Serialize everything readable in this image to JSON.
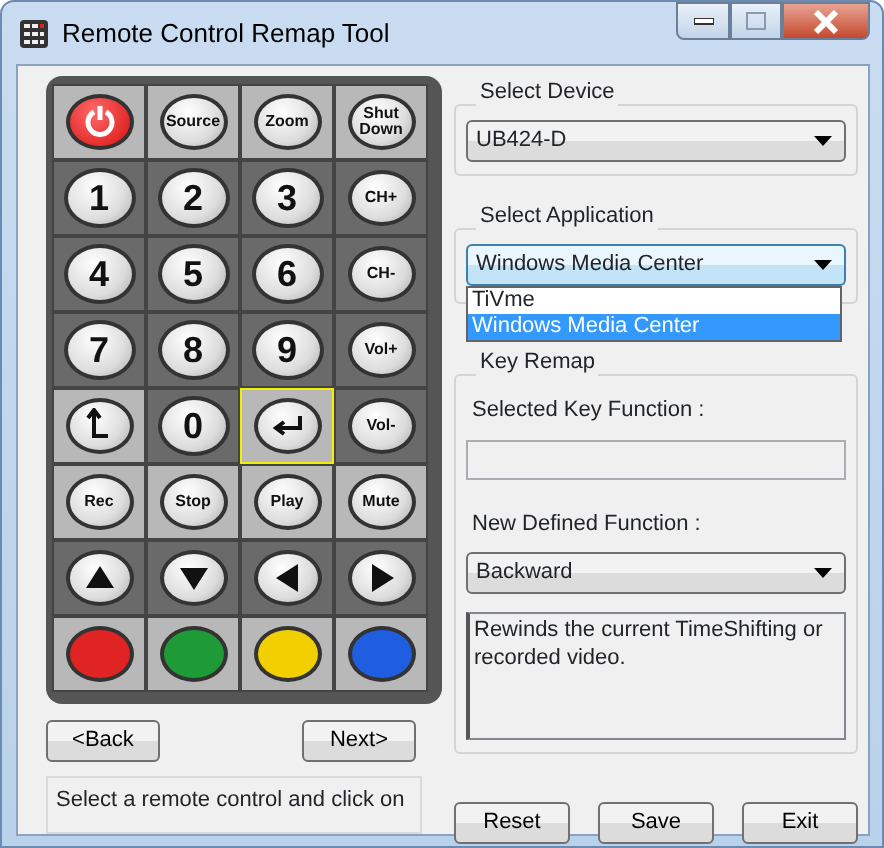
{
  "window": {
    "title": "Remote Control Remap Tool"
  },
  "remote": {
    "keys": [
      {
        "kind": "power",
        "selected": false
      },
      {
        "kind": "label",
        "label": "Source",
        "selected": false
      },
      {
        "kind": "label",
        "label": "Zoom",
        "selected": false
      },
      {
        "kind": "label",
        "label": "Shut Down",
        "selected": false
      },
      {
        "kind": "digit",
        "label": "1",
        "selected": false
      },
      {
        "kind": "digit",
        "label": "2",
        "selected": false
      },
      {
        "kind": "digit",
        "label": "3",
        "selected": false
      },
      {
        "kind": "rocker",
        "label": "CH+",
        "selected": false
      },
      {
        "kind": "digit",
        "label": "4",
        "selected": false
      },
      {
        "kind": "digit",
        "label": "5",
        "selected": false
      },
      {
        "kind": "digit",
        "label": "6",
        "selected": false
      },
      {
        "kind": "rocker",
        "label": "CH-",
        "selected": false
      },
      {
        "kind": "digit",
        "label": "7",
        "selected": false
      },
      {
        "kind": "digit",
        "label": "8",
        "selected": false
      },
      {
        "kind": "digit",
        "label": "9",
        "selected": false
      },
      {
        "kind": "rocker",
        "label": "Vol+",
        "selected": false
      },
      {
        "kind": "back",
        "selected": false
      },
      {
        "kind": "digit",
        "label": "0",
        "selected": false
      },
      {
        "kind": "enter",
        "selected": true
      },
      {
        "kind": "rocker",
        "label": "Vol-",
        "selected": false
      },
      {
        "kind": "label",
        "label": "Rec",
        "selected": false
      },
      {
        "kind": "label",
        "label": "Stop",
        "selected": false
      },
      {
        "kind": "label",
        "label": "Play",
        "selected": false
      },
      {
        "kind": "label",
        "label": "Mute",
        "selected": false
      },
      {
        "kind": "up",
        "selected": false
      },
      {
        "kind": "down",
        "selected": false
      },
      {
        "kind": "left",
        "selected": false
      },
      {
        "kind": "right",
        "selected": false
      },
      {
        "kind": "color",
        "color": "#e02424",
        "selected": false
      },
      {
        "kind": "color",
        "color": "#1e9a36",
        "selected": false
      },
      {
        "kind": "color",
        "color": "#f2d000",
        "selected": false
      },
      {
        "kind": "color",
        "color": "#1f5ee0",
        "selected": false
      }
    ]
  },
  "navigation": {
    "buttons": [
      "<Back",
      "Next>"
    ]
  },
  "status_text": "Select a remote control and click on",
  "device": {
    "legend": "Select Device",
    "value": "UB424-D"
  },
  "application": {
    "legend": "Select Application",
    "value": "Windows Media Center",
    "options": [
      {
        "label": "TiVme",
        "selected": false
      },
      {
        "label": "Windows Media Center",
        "selected": true
      }
    ]
  },
  "key_remap": {
    "legend": "Key Remap",
    "selected_key_label": "Selected Key Function :",
    "new_function_label": "New Defined Function :",
    "new_function_value": "Backward",
    "description": "Rewinds the current TimeShifting or recorded video."
  },
  "buttons": [
    "Reset",
    "Save",
    "Exit"
  ]
}
